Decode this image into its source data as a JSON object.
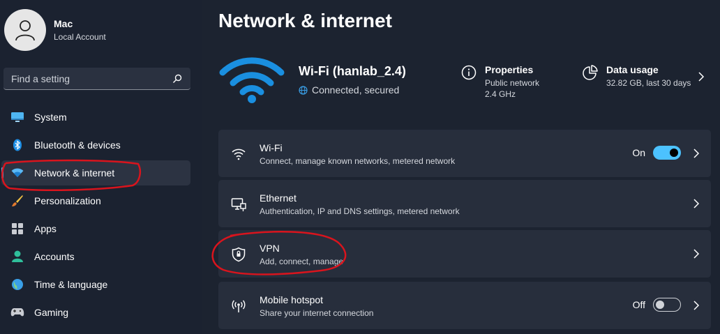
{
  "profile": {
    "name": "Mac",
    "account_type": "Local Account",
    "avatar_icon": "person-icon"
  },
  "search": {
    "placeholder": "Find a setting",
    "icon": "search-icon"
  },
  "sidebar": {
    "items": [
      {
        "label": "System",
        "icon": "system-icon",
        "active": false
      },
      {
        "label": "Bluetooth & devices",
        "icon": "bluetooth-icon",
        "active": false
      },
      {
        "label": "Network & internet",
        "icon": "network-icon",
        "active": true
      },
      {
        "label": "Personalization",
        "icon": "brush-icon",
        "active": false
      },
      {
        "label": "Apps",
        "icon": "apps-icon",
        "active": false
      },
      {
        "label": "Accounts",
        "icon": "accounts-icon",
        "active": false
      },
      {
        "label": "Time & language",
        "icon": "globe-icon",
        "active": false
      },
      {
        "label": "Gaming",
        "icon": "gamepad-icon",
        "active": false
      }
    ]
  },
  "page": {
    "title": "Network & internet"
  },
  "status": {
    "wifi_title": "Wi-Fi (hanlab_2.4)",
    "wifi_status": "Connected, secured",
    "properties": {
      "title": "Properties",
      "line1": "Public network",
      "line2": "2.4 GHz"
    },
    "data_usage": {
      "title": "Data usage",
      "value": "32.82 GB, last 30 days"
    }
  },
  "cards": {
    "wifi": {
      "title": "Wi-Fi",
      "subtitle": "Connect, manage known networks, metered network",
      "toggle_label": "On",
      "toggle_on": true
    },
    "ethernet": {
      "title": "Ethernet",
      "subtitle": "Authentication, IP and DNS settings, metered network"
    },
    "vpn": {
      "title": "VPN",
      "subtitle": "Add, connect, manage"
    },
    "hotspot": {
      "title": "Mobile hotspot",
      "subtitle": "Share your internet connection",
      "toggle_label": "Off",
      "toggle_on": false
    }
  },
  "colors": {
    "background": "#1c2330",
    "card": "#272e3c",
    "accent": "#4cc2ff",
    "wifi_blue": "#1a8fe0",
    "annotation_red": "#d9141d"
  }
}
